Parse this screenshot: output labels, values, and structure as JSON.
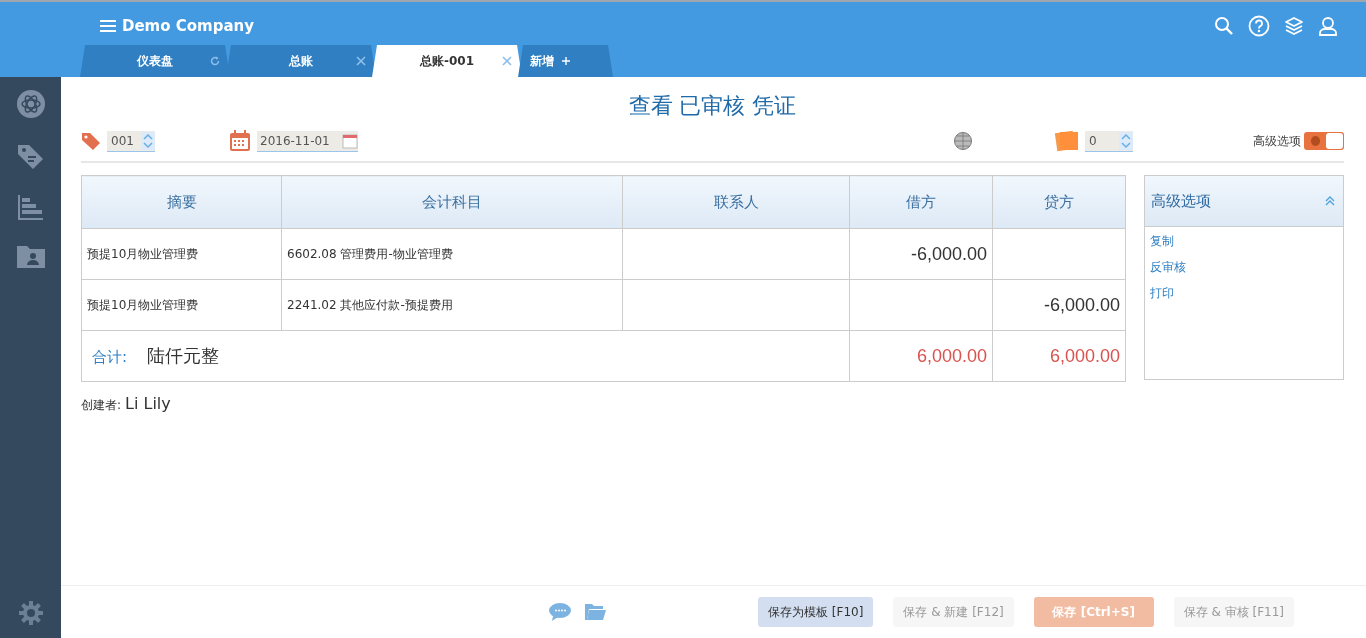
{
  "header": {
    "company": "Demo Company"
  },
  "tabs": [
    {
      "label": "仪表盘",
      "selected": false,
      "kind": "refresh"
    },
    {
      "label": "总账",
      "selected": false,
      "kind": "close"
    },
    {
      "label": "总账-001",
      "selected": true,
      "kind": "close"
    },
    {
      "label": "新增",
      "selected": false,
      "kind": "add"
    }
  ],
  "page_title": "查看 已审核 凭证",
  "voucher": {
    "number": "001",
    "date": "2016-11-01",
    "attachments": "0",
    "advanced_label": "高级选项",
    "advanced_on": true
  },
  "table": {
    "columns": [
      "摘要",
      "会计科目",
      "联系人",
      "借方",
      "贷方"
    ],
    "rows": [
      {
        "summary": "预提10月物业管理费",
        "account": "6602.08 管理费用-物业管理费",
        "contact": "",
        "debit": "-6,000.00",
        "credit": ""
      },
      {
        "summary": "预提10月物业管理费",
        "account": "2241.02 其他应付款-预提费用",
        "contact": "",
        "debit": "",
        "credit": "-6,000.00"
      }
    ],
    "total": {
      "label": "合计:",
      "words": "陆仟元整",
      "debit": "6,000.00",
      "credit": "6,000.00"
    }
  },
  "creator": {
    "label": "创建者:",
    "name": "Li Lily"
  },
  "side_panel": {
    "title": "高级选项",
    "expanded": true,
    "links": [
      "复制",
      "反审核",
      "打印"
    ]
  },
  "buttons": [
    {
      "label": "保存为模板 [F10]",
      "kind": "secondary",
      "disabled": false
    },
    {
      "label": "保存 & 新建 [F12]",
      "kind": "secondary",
      "disabled": true
    },
    {
      "label": "保存 [Ctrl+S]",
      "kind": "primary",
      "disabled": true
    },
    {
      "label": "保存 & 审核 [F11]",
      "kind": "secondary",
      "disabled": true
    }
  ]
}
